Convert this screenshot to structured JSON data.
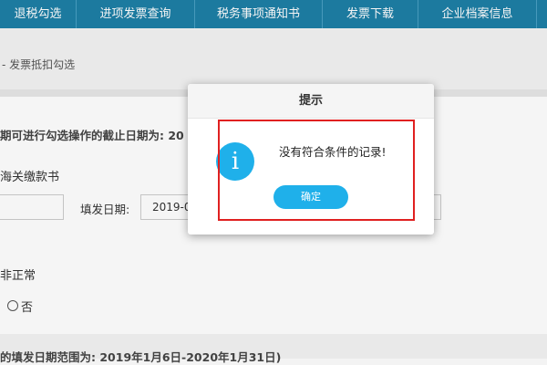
{
  "nav": {
    "items": [
      {
        "label": "退税勾选"
      },
      {
        "label": "进项发票查询"
      },
      {
        "label": "税务事项通知书"
      },
      {
        "label": "发票下载"
      },
      {
        "label": "企业档案信息"
      }
    ]
  },
  "breadcrumb": "- 发票抵扣勾选",
  "form": {
    "deadline_text": "期可进行勾选操作的截止日期为: 20",
    "customs_label": "海关缴款书",
    "fill_date_label": "填发日期:",
    "fill_date_value": "2019-0",
    "abnormal_label": "非正常",
    "radio_no_label": "否",
    "range_text": "的填发日期范围为: 2019年1月6日-2020年1月31日)"
  },
  "dialog": {
    "title": "提示",
    "icon": "info-icon",
    "message": "没有符合条件的记录!",
    "ok_label": "确定"
  },
  "colors": {
    "nav_bg": "#1e7fa6",
    "accent": "#1fb0ea",
    "highlight": "#e02020"
  }
}
